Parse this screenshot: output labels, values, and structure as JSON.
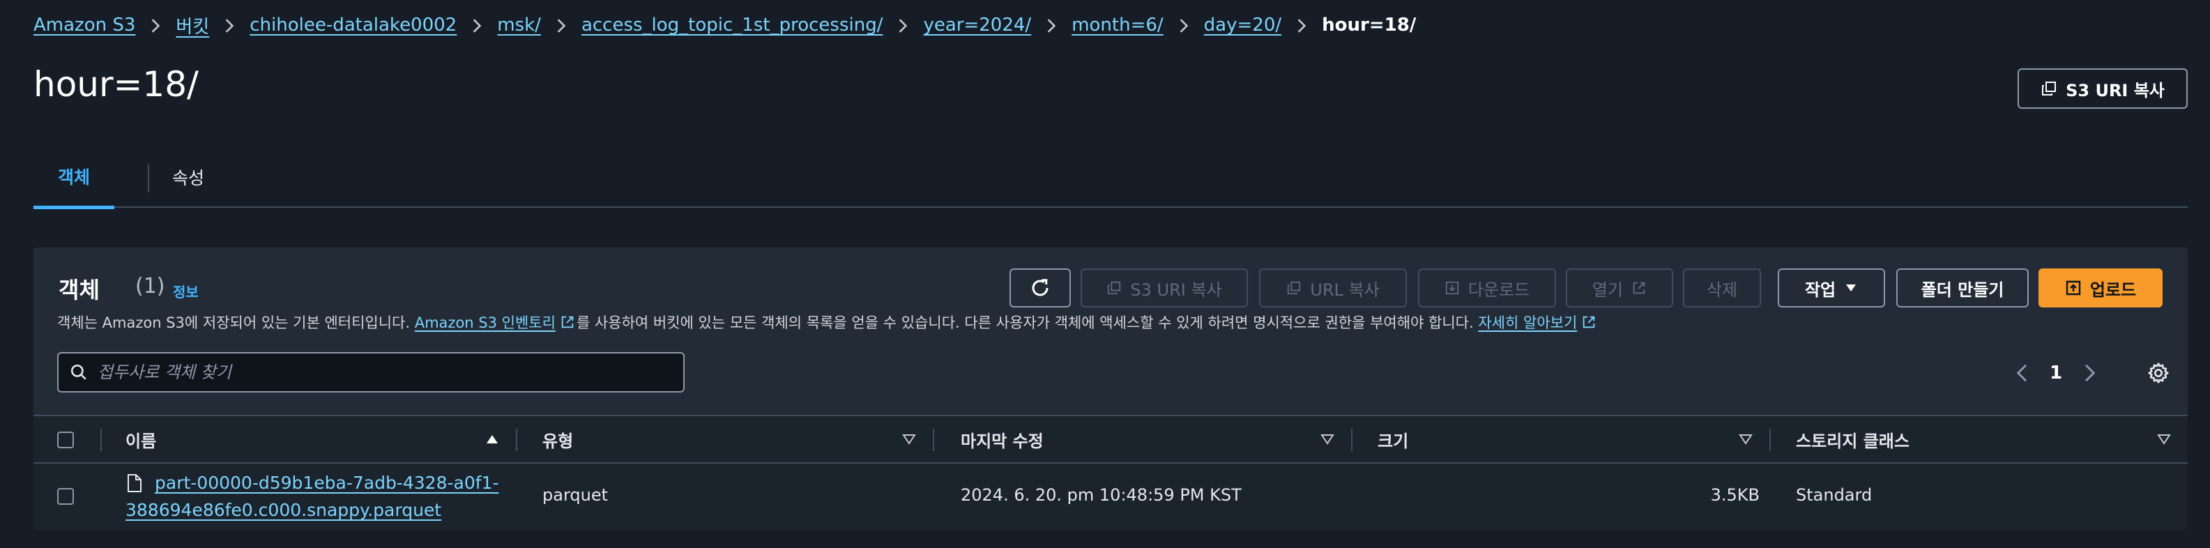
{
  "breadcrumb": {
    "items": [
      "Amazon S3",
      "버킷",
      "chiholee-datalake0002",
      "msk/",
      "access_log_topic_1st_processing/",
      "year=2024/",
      "month=6/",
      "day=20/"
    ],
    "current": "hour=18/"
  },
  "page": {
    "title": "hour=18/",
    "copy_uri_label": "S3 URI 복사"
  },
  "tabs": [
    "객체",
    "속성"
  ],
  "objects": {
    "title": "객체",
    "count": "(1)",
    "info_label": "정보",
    "description_before": "객체는 Amazon S3에 저장되어 있는 기본 엔터티입니다. ",
    "inventory_link": "Amazon S3 인벤토리",
    "description_middle": "를 사용하여 버킷에 있는 모든 객체의 목록을 얻을 수 있습니다. 다른 사용자가 객체에 액세스할 수 있게 하려면 명시적으로 권한을 부여해야 합니다. ",
    "learn_more_link": "자세히 알아보기",
    "search_placeholder": "접두사로 객체 찾기",
    "page_number": "1"
  },
  "toolbar": {
    "copy_s3_uri": "S3 URI 복사",
    "copy_url": "URL 복사",
    "download": "다운로드",
    "open": "열기",
    "delete": "삭제",
    "actions": "작업",
    "create_folder": "폴더 만들기",
    "upload": "업로드"
  },
  "table": {
    "columns": [
      "이름",
      "유형",
      "마지막 수정",
      "크기",
      "스토리지 클래스"
    ],
    "rows": [
      {
        "name_line1": "part-00000-d59b1eba-7adb-4328-a0f1-",
        "name_line2": "388694e86fe0.c000.snappy.parquet",
        "type": "parquet",
        "last_modified": "2024. 6. 20. pm 10:48:59 PM KST",
        "size": "3.5KB",
        "storage_class": "Standard"
      }
    ]
  },
  "colors": {
    "background": "#161d26",
    "panel": "#232b37",
    "link": "#7dd3fc",
    "active_tab": "#42b4ff",
    "primary_button": "#f89b2a"
  }
}
